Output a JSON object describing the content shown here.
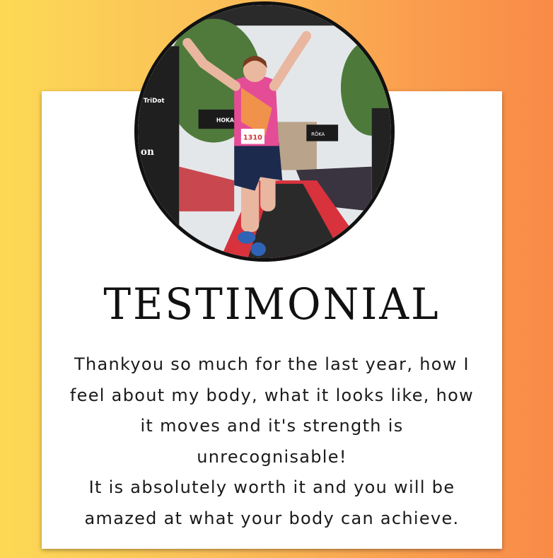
{
  "title": "TESTIMONIAL",
  "quote_lines": [
    " Thankyou so much for the last year, how I",
    "feel about my body, what it looks like, how",
    "it moves and it's strength is",
    "unrecognisable!",
    "It is absolutely worth it and you will be",
    "amazed at what your body can achieve."
  ],
  "photo": {
    "signs": [
      "TriDot",
      "on",
      "HOKA",
      "RŌKA"
    ],
    "bib": "1310"
  },
  "colors": {
    "gradient_start": "#fcd955",
    "gradient_end": "#f98a47",
    "card": "#ffffff",
    "text": "#1a1a1a"
  }
}
